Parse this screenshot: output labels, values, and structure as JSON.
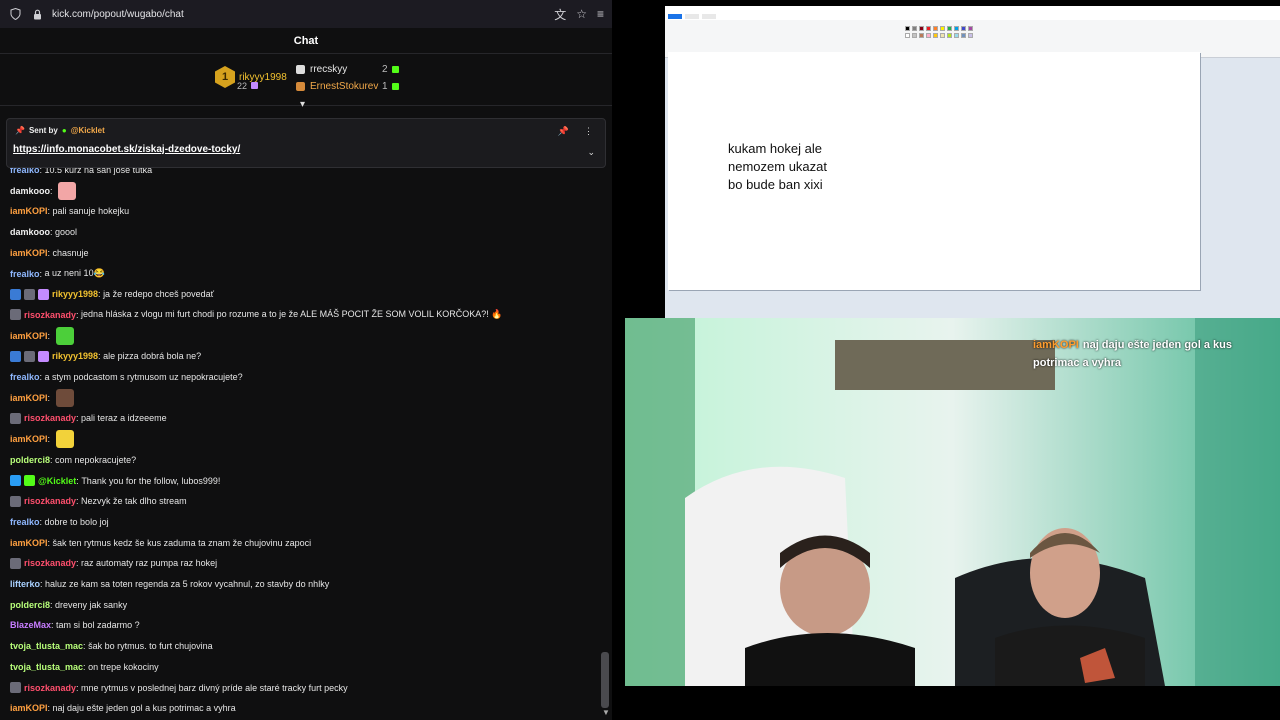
{
  "browser": {
    "url": "kick.com/popout/wugabo/chat"
  },
  "chat": {
    "title": "Chat",
    "leaderboard": {
      "top": {
        "rank": "1",
        "name": "rikyyy1998",
        "count": "22"
      },
      "others": [
        {
          "name": "rrecskyy",
          "count": "2",
          "color": "#e6e6e6"
        },
        {
          "name": "ErnestStokurev",
          "count": "1",
          "color": "#f2a94a"
        }
      ]
    },
    "pinned": {
      "sent_by": "Sent by",
      "sender": "@Kicklet",
      "link": "https://info.monacobet.sk/ziskaj-dzedove-tocky/"
    },
    "messages": [
      {
        "user": "frealko",
        "color": "#8fb8ff",
        "text": "10.5 kurz na san jose tutka",
        "badges": []
      },
      {
        "user": "damkooo",
        "color": "#f0f0f0",
        "text": "",
        "badges": [],
        "emote": "#f2a6a6"
      },
      {
        "user": "iamKOPI",
        "color": "#ffa040",
        "text": "pali sanuje hokejku",
        "badges": []
      },
      {
        "user": "damkooo",
        "color": "#f0f0f0",
        "text": "goool",
        "badges": []
      },
      {
        "user": "iamKOPI",
        "color": "#ffa040",
        "text": "chasnuje",
        "badges": []
      },
      {
        "user": "frealko",
        "color": "#8fb8ff",
        "text": "a uz neni 10😂",
        "badges": []
      },
      {
        "user": "rikyyy1998",
        "color": "#f2c230",
        "text": "ja že redepo chceš povedať",
        "badges": [
          "#3a7bd5",
          "#6b6b78",
          "#c48bff"
        ]
      },
      {
        "user": "risozkanady",
        "color": "#ff4f6d",
        "text": "jedna hláska z vlogu mi furt chodi po rozume a to je že ALE MÁŠ POCIT ŽE SOM VOLIL KORČOKA?! 🔥",
        "badges": [
          "#6b6b78"
        ]
      },
      {
        "user": "iamKOPI",
        "color": "#ffa040",
        "text": "",
        "badges": [],
        "emote": "#4ccf3a"
      },
      {
        "user": "rikyyy1998",
        "color": "#f2c230",
        "text": "ale pizza dobrá bola ne?",
        "badges": [
          "#3a7bd5",
          "#6b6b78",
          "#c48bff"
        ]
      },
      {
        "user": "frealko",
        "color": "#8fb8ff",
        "text": "a stym podcastom s rytmusom uz nepokracujete?",
        "badges": []
      },
      {
        "user": "iamKOPI",
        "color": "#ffa040",
        "text": "",
        "badges": [],
        "emote": "#6e4b3a"
      },
      {
        "user": "risozkanady",
        "color": "#ff4f6d",
        "text": "pali teraz a idzeeeme",
        "badges": [
          "#6b6b78"
        ]
      },
      {
        "user": "iamKOPI",
        "color": "#ffa040",
        "text": "",
        "badges": [],
        "emote": "#f2d23a"
      },
      {
        "user": "polderci8",
        "color": "#b8ff7a",
        "text": "com nepokracujete?",
        "badges": []
      },
      {
        "user": "@Kicklet",
        "color": "#53fc18",
        "text": "Thank you for the follow, lubos999!",
        "badges": [
          "#2a9df4",
          "#53fc18"
        ]
      },
      {
        "user": "risozkanady",
        "color": "#ff4f6d",
        "text": "Nezvyk že tak dlho stream",
        "badges": [
          "#6b6b78"
        ]
      },
      {
        "user": "frealko",
        "color": "#8fb8ff",
        "text": "dobre to bolo joj",
        "badges": []
      },
      {
        "user": "iamKOPI",
        "color": "#ffa040",
        "text": "šak ten rytmus kedz še kus zaduma ta znam že chujovinu zapoci",
        "badges": []
      },
      {
        "user": "risozkanady",
        "color": "#ff4f6d",
        "text": "raz automaty raz pumpa raz hokej",
        "badges": [
          "#6b6b78"
        ]
      },
      {
        "user": "lifterko",
        "color": "#a8d0ff",
        "text": "haluz ze kam sa toten regenda za 5 rokov vycahnul, zo stavby do nhlky",
        "badges": []
      },
      {
        "user": "polderci8",
        "color": "#b8ff7a",
        "text": "dreveny jak sanky",
        "badges": []
      },
      {
        "user": "BlazeMax",
        "color": "#c77dff",
        "text": "tam si bol zadarmo ?",
        "badges": []
      },
      {
        "user": "tvoja_tlusta_mac",
        "color": "#b8ff7a",
        "text": "šak bo rytmus. to furt chujovina",
        "badges": []
      },
      {
        "user": "tvoja_tlusta_mac",
        "color": "#b8ff7a",
        "text": "on trepe kokociny",
        "badges": []
      },
      {
        "user": "risozkanady",
        "color": "#ff4f6d",
        "text": "mne rytmus v poslednej barz divný príde ale staré tracky furt pecky",
        "badges": [
          "#6b6b78"
        ]
      },
      {
        "user": "iamKOPI",
        "color": "#ffa040",
        "text": "naj daju ešte jeden gol a kus potrimac a vyhra",
        "badges": []
      }
    ]
  },
  "paint": {
    "canvas_text": [
      "kukam hokej ale",
      "nemozem ukazat",
      "bo bude ban xixi"
    ]
  },
  "webcam_overlay": {
    "user": "iamKOPI",
    "text": "naj daju ešte jeden gol a kus potrimac a vyhra"
  }
}
